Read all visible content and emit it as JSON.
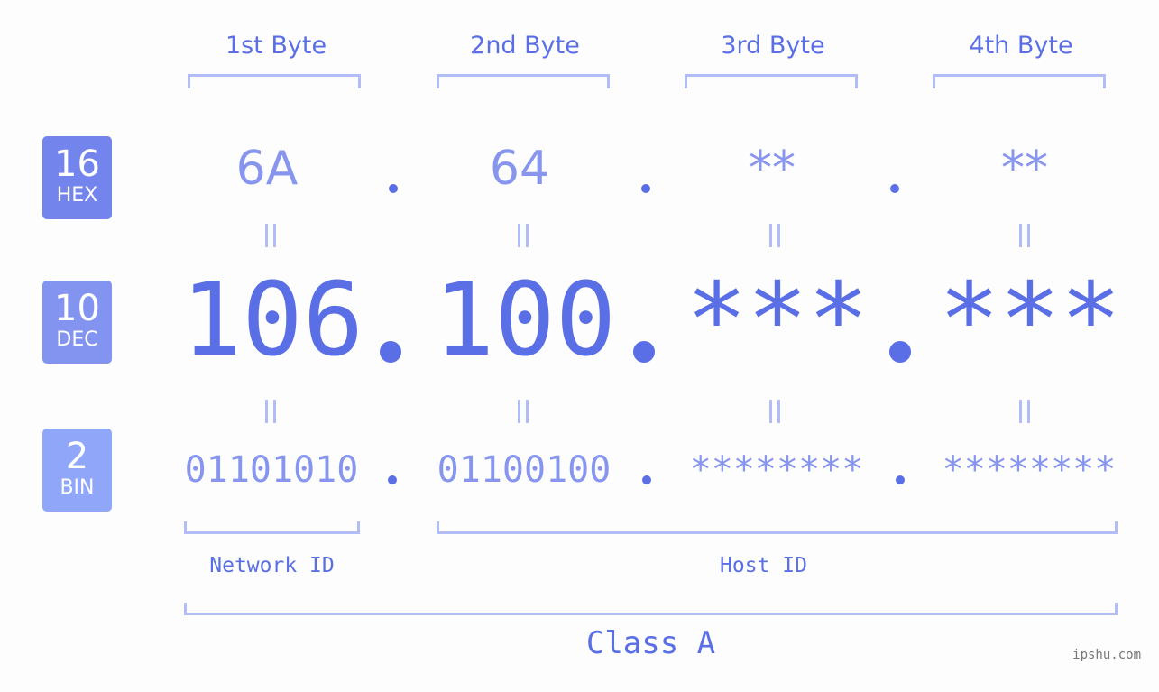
{
  "colors": {
    "background": "#fcfdfc",
    "accent": "#5a6fe6",
    "light_accent": "#8795ee",
    "bracket": "#b2bdf8",
    "badge_hex": "#7384ec",
    "badge_dec": "#8394f0",
    "badge_bin": "#90a6f9"
  },
  "badges": [
    {
      "number": "16",
      "label": "HEX"
    },
    {
      "number": "10",
      "label": "DEC"
    },
    {
      "number": "2",
      "label": "BIN"
    }
  ],
  "byte_headers": [
    "1st Byte",
    "2nd Byte",
    "3rd Byte",
    "4th Byte"
  ],
  "hex": [
    "6A",
    "64",
    "**",
    "**"
  ],
  "dec": [
    "106",
    "100",
    "***",
    "***"
  ],
  "bin": [
    "01101010",
    "01100100",
    "********",
    "********"
  ],
  "network_id_label": "Network ID",
  "host_id_label": "Host ID",
  "class_label": "Class A",
  "watermark": "ipshu.com"
}
